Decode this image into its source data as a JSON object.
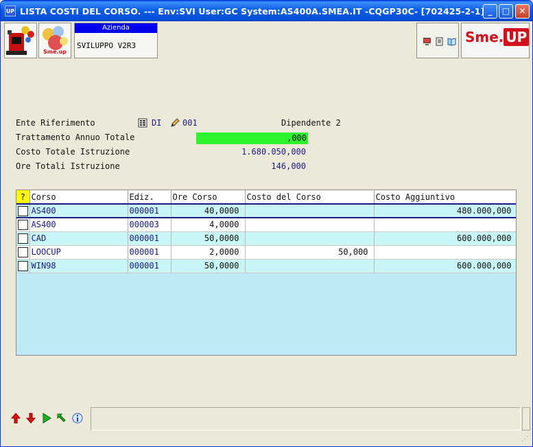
{
  "window": {
    "title": "LISTA COSTI DEL CORSO. --- Env:SVI User:GC System:AS400A.SMEA.IT -CQGP30C- [702425-2-1]",
    "app_icon_text": "UP",
    "minimize": "_",
    "maximize": "□",
    "close": "✕"
  },
  "toolbar": {
    "azienda_label": "Azienda",
    "azienda_value": "SVILUPPO V2R3",
    "brand_sme": "Sme.",
    "brand_up": "UP",
    "logo2_text": "Sme.up"
  },
  "form": {
    "ente_label": "Ente Riferimento",
    "ente_code": "DI",
    "ente_num": "001",
    "ente_desc": "Dipendente 2",
    "trattamento_label": "Trattamento Annuo Totale",
    "trattamento_value": ",000",
    "costo_label": "Costo Totale Istruzione",
    "costo_value": "1.680.050,000",
    "ore_label": "Ore Totali Istruzione",
    "ore_value": "146,000"
  },
  "table": {
    "columns": [
      "?",
      "Corso",
      "Ediz.",
      "Ore Corso",
      "Costo del Corso",
      "Costo Aggiuntivo"
    ],
    "rows": [
      {
        "corso": "AS400",
        "ediz": "000001",
        "ore": "40,0000",
        "costo": "",
        "aggiuntivo": "480.000,000"
      },
      {
        "corso": "AS400",
        "ediz": "000003",
        "ore": "4,0000",
        "costo": "",
        "aggiuntivo": ""
      },
      {
        "corso": "CAD",
        "ediz": "000001",
        "ore": "50,0000",
        "costo": "",
        "aggiuntivo": "600.000,000"
      },
      {
        "corso": "LOOCUP",
        "ediz": "000001",
        "ore": "2,0000",
        "costo": "50,000",
        "aggiuntivo": ""
      },
      {
        "corso": "WIN98",
        "ediz": "000001",
        "ore": "50,0000",
        "costo": "",
        "aggiuntivo": "600.000,000"
      }
    ]
  },
  "bottom": {
    "nav_icons": [
      "arrow-up-icon",
      "arrow-down-icon",
      "play-icon",
      "back-icon",
      "info-icon"
    ]
  },
  "colors": {
    "title_bar": "#0b5fe6",
    "green_field": "#2ef22e",
    "grid_bg": "#bde9f5",
    "row_alt": "#c8f6f6",
    "header_accent": "#0000f0",
    "brand_red": "#d0101a"
  }
}
